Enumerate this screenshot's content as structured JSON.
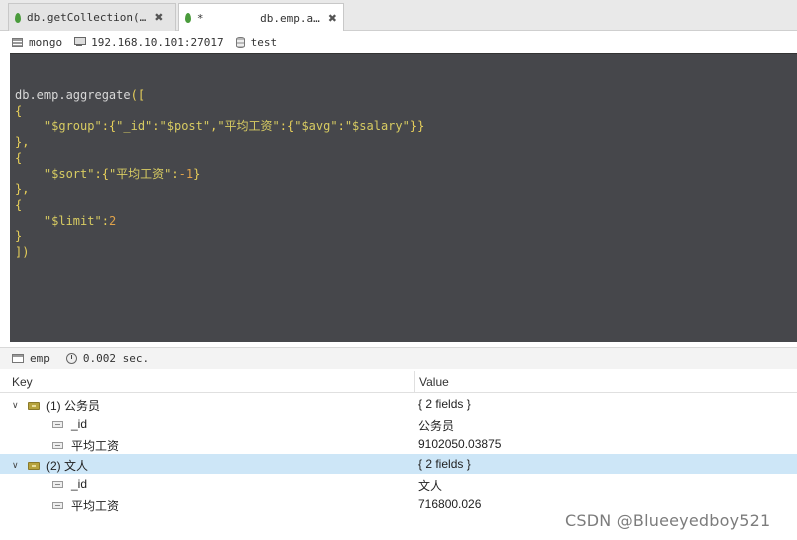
{
  "tabs": [
    {
      "label": "db.getCollection(…",
      "close": "✖"
    },
    {
      "label": "db.emp.a…",
      "modified": "*",
      "close": "✖"
    }
  ],
  "connection": {
    "server": "mongo",
    "address": "192.168.10.101:27017",
    "database": "test"
  },
  "editor": {
    "lines": [
      [
        {
          "t": "db.emp.aggregate",
          "c": "plain"
        },
        {
          "t": "([",
          "c": "brace"
        }
      ],
      [
        {
          "t": "{",
          "c": "brace"
        }
      ],
      [
        {
          "t": "    ",
          "c": "plain"
        },
        {
          "t": "\"$group\"",
          "c": "str"
        },
        {
          "t": ":{",
          "c": "brace"
        },
        {
          "t": "\"_id\"",
          "c": "str"
        },
        {
          "t": ":",
          "c": "brace"
        },
        {
          "t": "\"$post\"",
          "c": "str"
        },
        {
          "t": ",",
          "c": "brace"
        },
        {
          "t": "\"平均工资\"",
          "c": "str"
        },
        {
          "t": ":{",
          "c": "brace"
        },
        {
          "t": "\"$avg\"",
          "c": "str"
        },
        {
          "t": ":",
          "c": "brace"
        },
        {
          "t": "\"$salary\"",
          "c": "str"
        },
        {
          "t": "}}",
          "c": "brace"
        }
      ],
      [
        {
          "t": "},",
          "c": "brace"
        }
      ],
      [
        {
          "t": "{",
          "c": "brace"
        }
      ],
      [
        {
          "t": "    ",
          "c": "plain"
        },
        {
          "t": "\"$sort\"",
          "c": "str"
        },
        {
          "t": ":{",
          "c": "brace"
        },
        {
          "t": "\"平均工资\"",
          "c": "str"
        },
        {
          "t": ":",
          "c": "brace"
        },
        {
          "t": "-1",
          "c": "num"
        },
        {
          "t": "}",
          "c": "brace"
        }
      ],
      [
        {
          "t": "},",
          "c": "brace"
        }
      ],
      [
        {
          "t": "{",
          "c": "brace"
        }
      ],
      [
        {
          "t": "    ",
          "c": "plain"
        },
        {
          "t": "\"$limit\"",
          "c": "str"
        },
        {
          "t": ":",
          "c": "brace"
        },
        {
          "t": "2",
          "c": "num"
        }
      ],
      [
        {
          "t": "}",
          "c": "brace"
        }
      ],
      [
        {
          "t": "])",
          "c": "brace"
        }
      ]
    ]
  },
  "results_bar": {
    "collection": "emp",
    "time": "0.002 sec."
  },
  "results": {
    "columns": {
      "key": "Key",
      "value": "Value"
    },
    "rows": [
      {
        "key": "(1) 公务员",
        "value": "{ 2 fields }",
        "type": "doc",
        "expanded": true,
        "indent": 0,
        "selected": false
      },
      {
        "key": "_id",
        "value": "公务员",
        "type": "field",
        "indent": 1,
        "selected": false
      },
      {
        "key": "平均工资",
        "value": "9102050.03875",
        "type": "field",
        "indent": 1,
        "selected": false
      },
      {
        "key": "(2) 文人",
        "value": "{ 2 fields }",
        "type": "doc",
        "expanded": true,
        "indent": 0,
        "selected": true
      },
      {
        "key": "_id",
        "value": "文人",
        "type": "field",
        "indent": 1,
        "selected": false
      },
      {
        "key": "平均工资",
        "value": "716800.026",
        "type": "field",
        "indent": 1,
        "selected": false
      }
    ]
  },
  "watermark": "CSDN @Blueeyedboy521"
}
